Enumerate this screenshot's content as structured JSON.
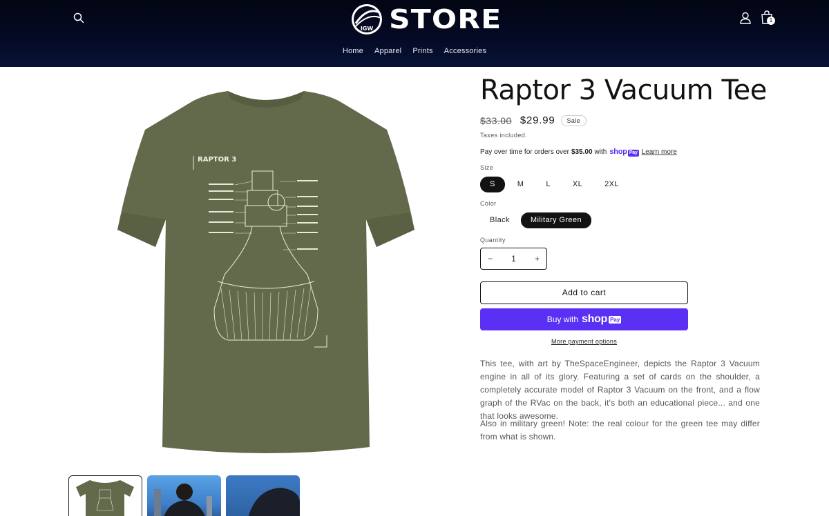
{
  "header": {
    "logo_badge_text": "IGW",
    "logo_text": "STORE",
    "cart_count": "1",
    "nav": [
      "Home",
      "Apparel",
      "Prints",
      "Accessories"
    ],
    "icons": {
      "search": "search-icon",
      "account": "user-icon",
      "cart": "bag-icon"
    }
  },
  "product": {
    "title": "Raptor 3 Vacuum Tee",
    "price_original": "$33.00",
    "price_sale": "$29.99",
    "sale_badge": "Sale",
    "taxes_note": "Taxes included.",
    "installments": {
      "prefix": "Pay over time for orders over",
      "threshold": "$35.00",
      "with": "with",
      "brand": "shop",
      "brand_pill": "Pay",
      "learn_more": "Learn more"
    },
    "size": {
      "label": "Size",
      "options": [
        "S",
        "M",
        "L",
        "XL",
        "2XL"
      ],
      "selected": "S"
    },
    "color": {
      "label": "Color",
      "options": [
        "Black",
        "Military Green"
      ],
      "selected": "Military Green"
    },
    "quantity": {
      "label": "Quantity",
      "value": "1",
      "minus": "−",
      "plus": "+"
    },
    "add_to_cart": "Add to cart",
    "buy_with": "Buy with",
    "buy_brand": "shop",
    "buy_brand_pill": "Pay",
    "more_payment": "More payment options",
    "description": [
      "This tee, with art by TheSpaceEngineer, depicts the Raptor 3 Vacuum engine in all of its glory. Featuring a set of cards on the shoulder, a completely accurate model of Raptor 3 Vacuum on the front, and a flow graph of the RVac on the back, it's both an educational piece... and one that looks awesome.",
      "Also in military green! Note: the real colour for the green tee may differ from what is shown."
    ]
  },
  "image": {
    "print_title": "RAPTOR 3",
    "shirt_color": "#636a4c"
  }
}
